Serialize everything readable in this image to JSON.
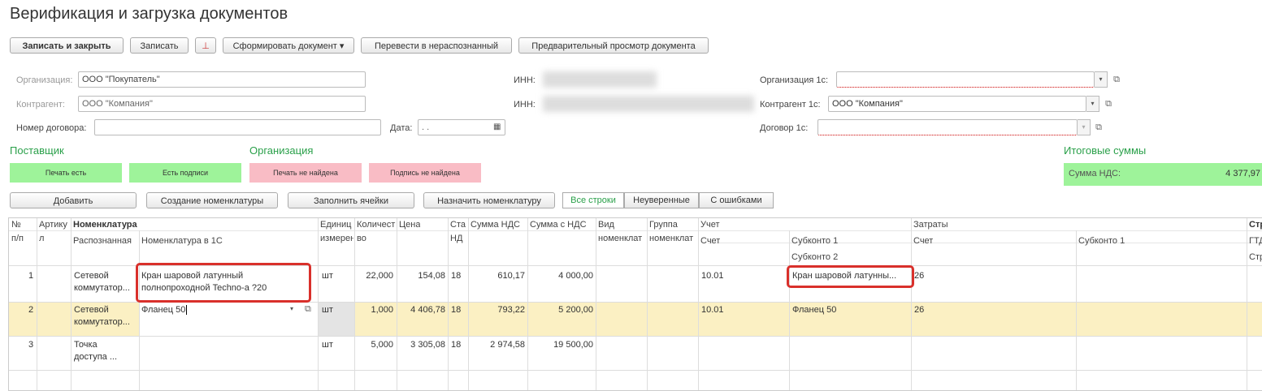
{
  "title": "Верификация и загрузка документов",
  "toolbar": {
    "write_close": "Записать и закрыть",
    "write": "Записать",
    "form_doc": "Сформировать документ",
    "to_unrecognized": "Перевести в нераспознанный",
    "preview": "Предварительный просмотр документа"
  },
  "form": {
    "org_label": "Организация:",
    "org_value": "ООО \"Покупатель\"",
    "kontr_label": "Контрагент:",
    "kontr_value": "ООО \"Компания\"",
    "dogovor_label": "Номер договора:",
    "date_label": "Дата:",
    "date_value": ". .",
    "inn_label": "ИНН:",
    "inn2_label": "ИНН:",
    "org1c_label": "Организация 1с:",
    "kontr1c_label": "Контрагент 1с:",
    "kontr1c_value": "ООО \"Компания\"",
    "dogovor1c_label": "Договор 1с:"
  },
  "sections": {
    "supplier": "Поставщик",
    "organization": "Организация",
    "totals": "Итоговые суммы"
  },
  "status": {
    "print_yes": "Печать есть",
    "sign_yes": "Есть подписи",
    "print_no": "Печать не найдена",
    "sign_no": "Подпись не найдена"
  },
  "totals": {
    "vat_label": "Сумма НДС:",
    "vat_value": "4 377,97"
  },
  "actions": {
    "add": "Добавить",
    "create_nom": "Создание номенклатуры",
    "fill_cells": "Заполнить ячейки",
    "assign_nom": "Назначить номенклатуру",
    "all_rows": "Все строки",
    "uncertain": "Неуверенные",
    "with_errors": "С ошибками"
  },
  "grid": {
    "headers": {
      "num": "№",
      "num2": "п/п",
      "art": "Артику",
      "art2": "л",
      "nom": "Номенклатура",
      "recog": "Распознанная",
      "nom1c": "Номенклатура в 1С",
      "unit": "Единиц",
      "unit2": "измерен",
      "qty": "Количест",
      "qty2": "во",
      "price": "Цена",
      "vat_rate": "Ста",
      "vat_rate2": "НД",
      "vat_sum": "Сумма НДС",
      "sum_vat": "Сумма с НДС",
      "kind": "Вид",
      "kind2": "номенклат",
      "group": "Группа",
      "group2": "номенклат",
      "acc": "Учет",
      "acc_acc": "Счет",
      "sub1": "Субконто 1",
      "sub2": "Субконто 2",
      "cost": "Затраты",
      "cost_acc": "Счет",
      "cost_sub1": "Субконто 1",
      "str": "Стр",
      "gtd": "ГТД",
      "str2": "Стр"
    },
    "rows": [
      {
        "n": "1",
        "recog1": "Сетевой",
        "recog2": "коммутатор...",
        "nom1": "Кран шаровой латунный",
        "nom2": "полнопроходной Techno-a ?20",
        "unit": "шт",
        "qty": "22,000",
        "price": "154,08",
        "rate": "18",
        "vat": "610,17",
        "sum": "4 000,00",
        "acc": "10.01",
        "sub1": "Кран шаровой латунны...",
        "cacc": "26"
      },
      {
        "n": "2",
        "recog1": "Сетевой",
        "recog2": "коммутатор...",
        "nom1": "Фланец 50",
        "nom2": "",
        "unit": "шт",
        "qty": "1,000",
        "price": "4 406,78",
        "rate": "18",
        "vat": "793,22",
        "sum": "5 200,00",
        "acc": "10.01",
        "sub1": "Фланец 50",
        "cacc": "26"
      },
      {
        "n": "3",
        "recog1": "Точка",
        "recog2": "доступа ...",
        "nom1": "",
        "nom2": "",
        "unit": "шт",
        "qty": "5,000",
        "price": "3 305,08",
        "rate": "18",
        "vat": "2 974,58",
        "sum": "19 500,00",
        "acc": "",
        "sub1": "",
        "cacc": ""
      }
    ]
  }
}
